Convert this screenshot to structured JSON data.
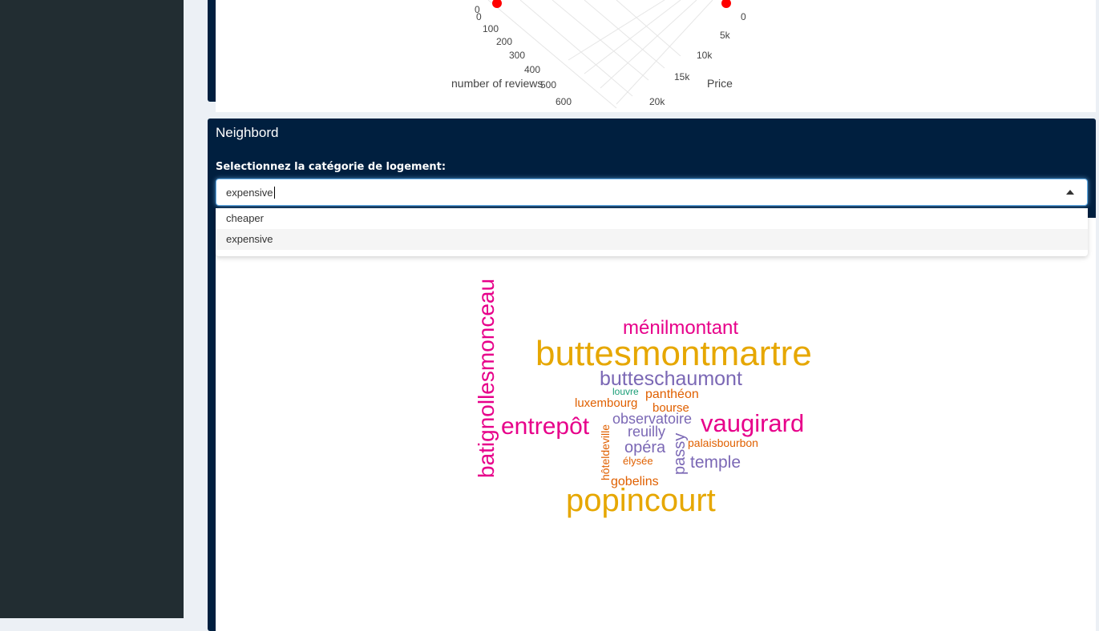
{
  "plot3d": {
    "x_axis_title": "number of reviews",
    "x_ticks": [
      "0",
      "100",
      "200",
      "300",
      "400",
      "500",
      "600"
    ],
    "y_axis_title": "Price",
    "y_ticks": [
      "0",
      "5k",
      "10k",
      "15k",
      "20k"
    ],
    "marker_color": "#ff0000"
  },
  "neighbor_box": {
    "title": "Neighbord",
    "select_label": "Selectionnez la catégorie de logement:",
    "select_value": "expensive",
    "options": [
      "cheaper",
      "expensive"
    ],
    "header_color": "#001f3f"
  },
  "wordcloud": {
    "words": [
      {
        "text": "buttesmontmartre",
        "color": "#e6a700"
      },
      {
        "text": "popincourt",
        "color": "#e6a700"
      },
      {
        "text": "batignollesmonceau",
        "color": "#e7008a"
      },
      {
        "text": "vaugirard",
        "color": "#e7008a"
      },
      {
        "text": "entrepôt",
        "color": "#e7008a"
      },
      {
        "text": "ménilmontant",
        "color": "#e7008a"
      },
      {
        "text": "butteschaumont",
        "color": "#7b68b5"
      },
      {
        "text": "temple",
        "color": "#7b68b5"
      },
      {
        "text": "opéra",
        "color": "#7b68b5"
      },
      {
        "text": "passy",
        "color": "#7b68b5"
      },
      {
        "text": "observatoire",
        "color": "#7b68b5"
      },
      {
        "text": "reuilly",
        "color": "#7b68b5"
      },
      {
        "text": "panthéon",
        "color": "#e06000"
      },
      {
        "text": "luxembourg",
        "color": "#e06000"
      },
      {
        "text": "bourse",
        "color": "#e06000"
      },
      {
        "text": "palaisbourbon",
        "color": "#e06000"
      },
      {
        "text": "gobelins",
        "color": "#e06000"
      },
      {
        "text": "élysée",
        "color": "#e06000"
      },
      {
        "text": "hôteldeville",
        "color": "#e06000"
      },
      {
        "text": "louvre",
        "color": "#1a9e77"
      }
    ]
  }
}
